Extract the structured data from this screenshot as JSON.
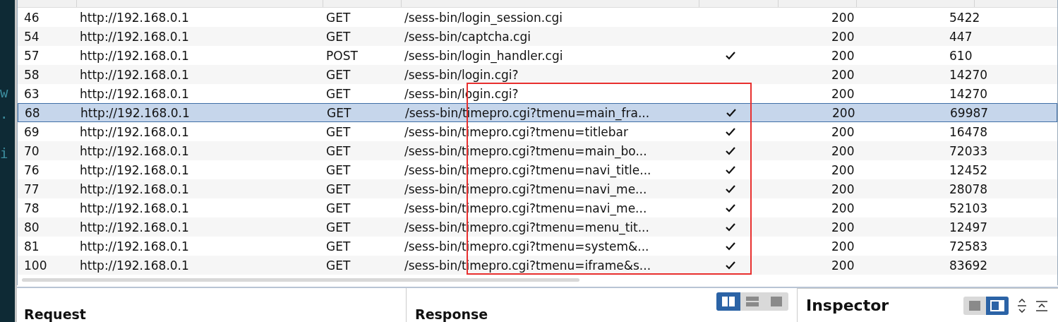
{
  "background_terminal": [
    "w",
    ".",
    "i"
  ],
  "table": {
    "rows": [
      {
        "number": "46",
        "host": "http://192.168.0.1",
        "method": "GET",
        "url": "/sess-bin/login_session.cgi",
        "checked": false,
        "status": "200",
        "length": "5422",
        "selected": false
      },
      {
        "number": "54",
        "host": "http://192.168.0.1",
        "method": "GET",
        "url": "/sess-bin/captcha.cgi",
        "checked": false,
        "status": "200",
        "length": "447",
        "selected": false
      },
      {
        "number": "57",
        "host": "http://192.168.0.1",
        "method": "POST",
        "url": "/sess-bin/login_handler.cgi",
        "checked": true,
        "status": "200",
        "length": "610",
        "selected": false
      },
      {
        "number": "58",
        "host": "http://192.168.0.1",
        "method": "GET",
        "url": "/sess-bin/login.cgi?",
        "checked": false,
        "status": "200",
        "length": "14270",
        "selected": false
      },
      {
        "number": "63",
        "host": "http://192.168.0.1",
        "method": "GET",
        "url": "/sess-bin/login.cgi?",
        "checked": false,
        "status": "200",
        "length": "14270",
        "selected": false
      },
      {
        "number": "68",
        "host": "http://192.168.0.1",
        "method": "GET",
        "url": "/sess-bin/timepro.cgi?tmenu=main_fra...",
        "checked": true,
        "status": "200",
        "length": "69987",
        "selected": true
      },
      {
        "number": "69",
        "host": "http://192.168.0.1",
        "method": "GET",
        "url": "/sess-bin/timepro.cgi?tmenu=titlebar",
        "checked": true,
        "status": "200",
        "length": "16478",
        "selected": false
      },
      {
        "number": "70",
        "host": "http://192.168.0.1",
        "method": "GET",
        "url": "/sess-bin/timepro.cgi?tmenu=main_bo...",
        "checked": true,
        "status": "200",
        "length": "72033",
        "selected": false
      },
      {
        "number": "76",
        "host": "http://192.168.0.1",
        "method": "GET",
        "url": "/sess-bin/timepro.cgi?tmenu=navi_title...",
        "checked": true,
        "status": "200",
        "length": "12452",
        "selected": false
      },
      {
        "number": "77",
        "host": "http://192.168.0.1",
        "method": "GET",
        "url": "/sess-bin/timepro.cgi?tmenu=navi_me...",
        "checked": true,
        "status": "200",
        "length": "28078",
        "selected": false
      },
      {
        "number": "78",
        "host": "http://192.168.0.1",
        "method": "GET",
        "url": "/sess-bin/timepro.cgi?tmenu=navi_me...",
        "checked": true,
        "status": "200",
        "length": "52103",
        "selected": false
      },
      {
        "number": "80",
        "host": "http://192.168.0.1",
        "method": "GET",
        "url": "/sess-bin/timepro.cgi?tmenu=menu_tit...",
        "checked": true,
        "status": "200",
        "length": "12497",
        "selected": false
      },
      {
        "number": "81",
        "host": "http://192.168.0.1",
        "method": "GET",
        "url": "/sess-bin/timepro.cgi?tmenu=system&...",
        "checked": true,
        "status": "200",
        "length": "72583",
        "selected": false
      },
      {
        "number": "100",
        "host": "http://192.168.0.1",
        "method": "GET",
        "url": "/sess-bin/timepro.cgi?tmenu=iframe&s...",
        "checked": true,
        "status": "200",
        "length": "83692",
        "selected": false
      }
    ],
    "annotation": {
      "color": "#e8302f"
    }
  },
  "request_panel": {
    "title": "Request"
  },
  "response_panel": {
    "title": "Response",
    "layout_toggle": [
      {
        "kind": "columns",
        "selected": true
      },
      {
        "kind": "rows",
        "selected": false
      },
      {
        "kind": "single",
        "selected": false
      }
    ]
  },
  "inspector": {
    "title": "Inspector",
    "view_toggle": [
      {
        "kind": "square",
        "selected": false
      },
      {
        "kind": "sidebar",
        "selected": true
      }
    ]
  }
}
